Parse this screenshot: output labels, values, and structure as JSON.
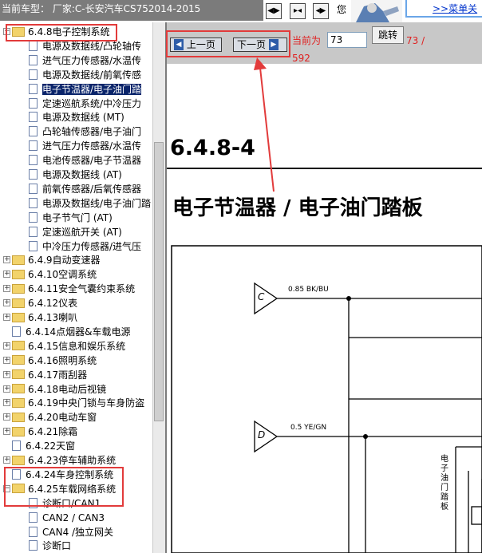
{
  "header": {
    "car_model_label": "当前车型： 厂家:C-长安汽车CS752014-2015",
    "toolbar_text": "您",
    "menu_link": ">>菜单关"
  },
  "tree": {
    "items": [
      {
        "label": "6.4.8电子控制系统",
        "type": "folder-open"
      },
      {
        "label": "电源及数据线/凸轮轴传",
        "type": "page"
      },
      {
        "label": "进气压力传感器/水温传",
        "type": "page"
      },
      {
        "label": "电源及数据线/前氧传感",
        "type": "page"
      },
      {
        "label": "电子节温器/电子油门踏",
        "type": "page"
      },
      {
        "label": "定速巡航系统/中冷压力",
        "type": "page"
      },
      {
        "label": "电源及数据线 (MT)",
        "type": "page"
      },
      {
        "label": "凸轮轴传感器/电子油门",
        "type": "page"
      },
      {
        "label": "进气压力传感器/水温传",
        "type": "page"
      },
      {
        "label": "电池传感器/电子节温器",
        "type": "page"
      },
      {
        "label": "电源及数据线 (AT)",
        "type": "page"
      },
      {
        "label": "前氧传感器/后氧传感器",
        "type": "page"
      },
      {
        "label": "电源及数据线/电子油门踏",
        "type": "page"
      },
      {
        "label": "电子节气门 (AT)",
        "type": "page"
      },
      {
        "label": "定速巡航开关 (AT)",
        "type": "page"
      },
      {
        "label": "中冷压力传感器/进气压",
        "type": "page"
      },
      {
        "label": "6.4.9自动变速器",
        "type": "folder"
      },
      {
        "label": "6.4.10空调系统",
        "type": "folder"
      },
      {
        "label": "6.4.11安全气囊约束系统",
        "type": "folder"
      },
      {
        "label": "6.4.12仪表",
        "type": "folder"
      },
      {
        "label": "6.4.13喇叭",
        "type": "folder"
      },
      {
        "label": "6.4.14点烟器&车载电源",
        "type": "leaf"
      },
      {
        "label": "6.4.15信息和娱乐系统",
        "type": "folder"
      },
      {
        "label": "6.4.16照明系统",
        "type": "folder"
      },
      {
        "label": "6.4.17雨刮器",
        "type": "folder"
      },
      {
        "label": "6.4.18电动后视镜",
        "type": "folder"
      },
      {
        "label": "6.4.19中央门锁与车身防盗",
        "type": "folder"
      },
      {
        "label": "6.4.20电动车窗",
        "type": "folder"
      },
      {
        "label": "6.4.21除霜",
        "type": "folder"
      },
      {
        "label": "6.4.22天窗",
        "type": "leaf"
      },
      {
        "label": "6.4.23停车辅助系统",
        "type": "folder"
      },
      {
        "label": "6.4.24车身控制系统",
        "type": "leaf"
      },
      {
        "label": "6.4.25车载网络系统",
        "type": "folder-open"
      },
      {
        "label": "诊断口/CAN1",
        "type": "page"
      },
      {
        "label": "CAN2 / CAN3",
        "type": "page"
      },
      {
        "label": "CAN4 /独立网关",
        "type": "page"
      },
      {
        "label": "诊断口",
        "type": "page"
      }
    ]
  },
  "nav": {
    "prev_label": "上一页",
    "next_label": "下一页",
    "current_label": "当前为",
    "page_value": "73",
    "jump_label": "跳转",
    "total_part1": "73 /",
    "total_part2": "592"
  },
  "doc": {
    "section_number": "6.4.8-4",
    "title": "电子节温器 / 电子油门踏板",
    "connector_c": "C",
    "connector_d": "D",
    "wire1": "0.85 BK/BU",
    "wire2": "0.5 YE/GN",
    "component_label": "电子油门踏板"
  }
}
